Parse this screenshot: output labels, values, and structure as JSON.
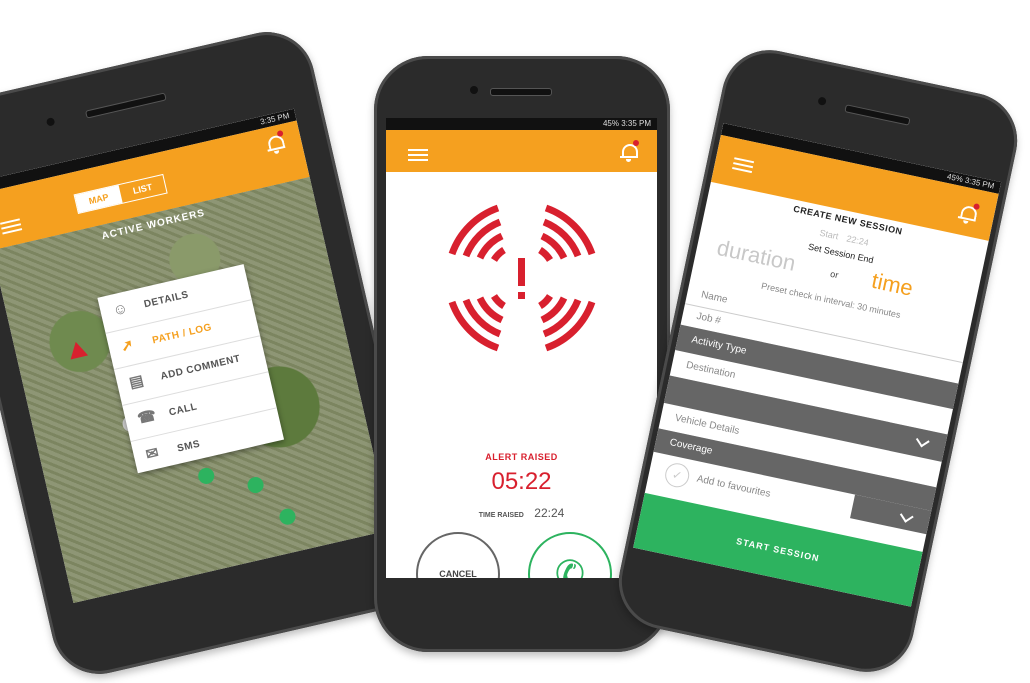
{
  "status": {
    "time": "3:35 PM",
    "battery": "45%"
  },
  "screen1": {
    "tab_map": "MAP",
    "tab_list": "LIST",
    "title": "ACTIVE WORKERS",
    "menu": [
      "DETAILS",
      "PATH / LOG",
      "ADD COMMENT",
      "CALL",
      "SMS"
    ]
  },
  "screen2": {
    "alert_label": "ALERT RAISED",
    "timer": "05:22",
    "time_raised_label": "TIME RAISED",
    "time_raised_value": "22:24",
    "cancel_label": "CANCEL"
  },
  "screen3": {
    "title": "CREATE NEW SESSION",
    "start_label": "Start",
    "start_value": "22:24",
    "set_end_label": "Set Session End",
    "duration_label": "duration",
    "or_label": "or",
    "time_label": "time",
    "preset_text": "Preset check in interval: 30 minutes",
    "fields": [
      "Name",
      "Job #",
      "Activity Type",
      "Destination",
      "Vehicle Details",
      "Coverage"
    ],
    "favourites_label": "Add to favourites",
    "start_button": "START SESSION"
  },
  "colors": {
    "accent": "#f5a01f",
    "alert": "#d8202e",
    "call": "#2db35f",
    "button": "#2db35f"
  }
}
